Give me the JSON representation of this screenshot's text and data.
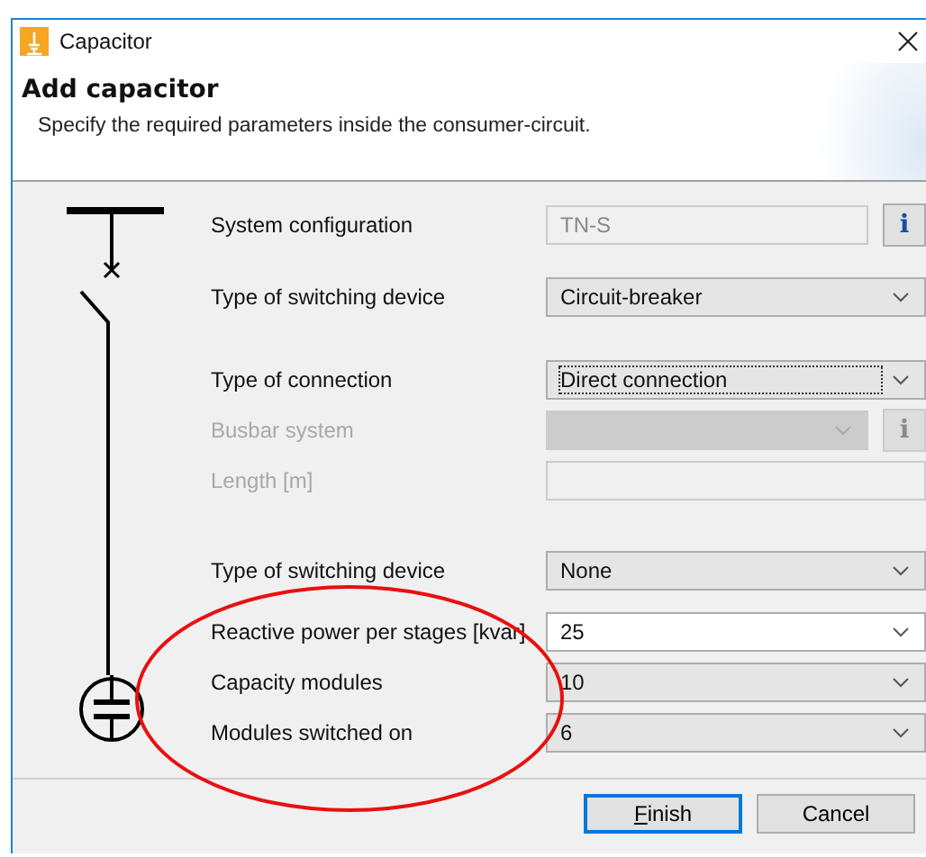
{
  "window": {
    "title": "Capacitor"
  },
  "header": {
    "title": "Add capacitor",
    "subtitle": "Specify the required parameters inside the consumer-circuit."
  },
  "sections": [
    [
      {
        "kind": "text",
        "label": "System configuration",
        "value": "TN-S",
        "disabled": false,
        "readonly": true,
        "focused": false,
        "info_label": "i"
      },
      {
        "kind": "combo",
        "label": "Type of switching device",
        "value": "Circuit-breaker",
        "disabled": false,
        "readonly": false,
        "focused": false
      }
    ],
    [
      {
        "kind": "combo",
        "label": "Type of connection",
        "value": "Direct connection",
        "disabled": false,
        "readonly": false,
        "focused": true
      },
      {
        "kind": "combo",
        "label": "Busbar system",
        "disabled": true,
        "readonly": false,
        "focused": false,
        "info_label": "i"
      },
      {
        "kind": "text",
        "label": "Length [m]",
        "disabled": true,
        "readonly": false,
        "focused": false
      }
    ],
    [
      {
        "kind": "combo",
        "label": "Type of switching device",
        "value": "None",
        "disabled": false,
        "readonly": false,
        "focused": false
      },
      {
        "kind": "editcombo",
        "label": "Reactive power per stages [kvar]",
        "value": "25",
        "disabled": false,
        "readonly": false,
        "focused": false
      },
      {
        "kind": "combo",
        "label": "Capacity modules",
        "value": "10",
        "disabled": false,
        "readonly": false,
        "focused": false
      },
      {
        "kind": "combo",
        "label": "Modules switched on",
        "value": "6",
        "disabled": false,
        "readonly": false,
        "focused": false
      }
    ]
  ],
  "annotation": {
    "kind": "ellipse",
    "color": "#e81010"
  },
  "buttons": [
    {
      "label": "Finish",
      "default": true,
      "mnemonic": true
    },
    {
      "label": "Cancel",
      "default": false,
      "mnemonic": false
    }
  ]
}
